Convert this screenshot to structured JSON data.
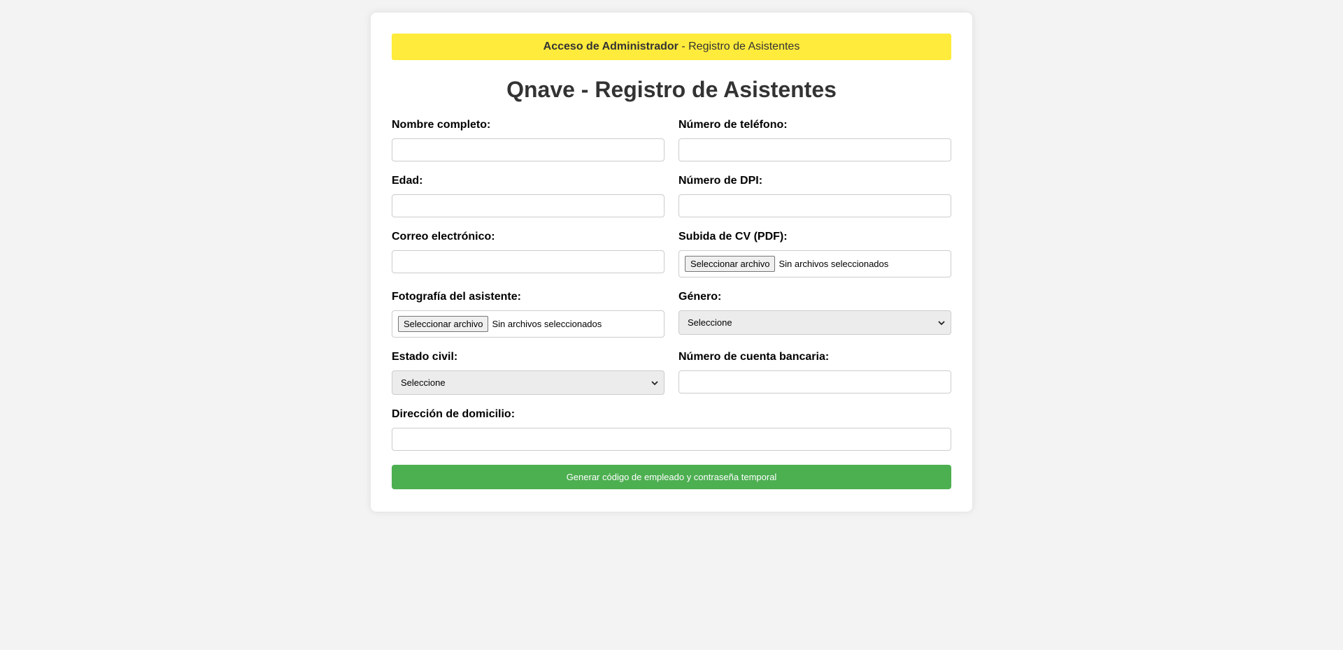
{
  "banner": {
    "bold_text": "Acceso de Administrador",
    "rest_text": " - Registro de Asistentes"
  },
  "page_title": "Qnave - Registro de Asistentes",
  "fields": {
    "full_name": {
      "label": "Nombre completo:",
      "value": ""
    },
    "phone": {
      "label": "Número de teléfono:",
      "value": ""
    },
    "age": {
      "label": "Edad:",
      "value": ""
    },
    "dpi": {
      "label": "Número de DPI:",
      "value": ""
    },
    "email": {
      "label": "Correo electrónico:",
      "value": ""
    },
    "cv_upload": {
      "label": "Subida de CV (PDF):",
      "button": "Seleccionar archivo",
      "status": "Sin archivos seleccionados"
    },
    "photo": {
      "label": "Fotografía del asistente:",
      "button": "Seleccionar archivo",
      "status": "Sin archivos seleccionados"
    },
    "gender": {
      "label": "Género:",
      "selected": "Seleccione"
    },
    "marital_status": {
      "label": "Estado civil:",
      "selected": "Seleccione"
    },
    "bank_account": {
      "label": "Número de cuenta bancaria:",
      "value": ""
    },
    "address": {
      "label": "Dirección de domicilio:",
      "value": ""
    }
  },
  "submit_label": "Generar código de empleado y contraseña temporal",
  "colors": {
    "banner_bg": "#ffeb3b",
    "submit_bg": "#4caf50",
    "page_bg": "#f3f3f3"
  }
}
